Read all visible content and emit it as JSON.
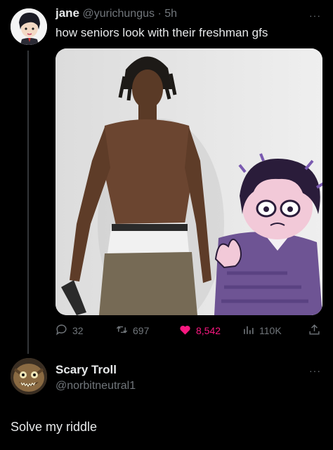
{
  "tweet": {
    "display_name": "jane",
    "handle": "@yurichungus",
    "separator": "·",
    "time": "5h",
    "text": "how seniors look with their freshman gfs",
    "more_label": "···"
  },
  "actions": {
    "replies": "32",
    "retweets": "697",
    "likes": "8,542",
    "views": "110K"
  },
  "reply": {
    "display_name": "Scary Troll",
    "handle": "@norbitneutral1",
    "more_label": "···",
    "text": "Solve my riddle"
  },
  "colors": {
    "background": "#000000",
    "text": "#e7e9ea",
    "muted": "#71767b",
    "like": "#f91880"
  },
  "icons": [
    "reply-icon",
    "retweet-icon",
    "heart-icon",
    "views-icon",
    "share-icon",
    "more-icon"
  ]
}
